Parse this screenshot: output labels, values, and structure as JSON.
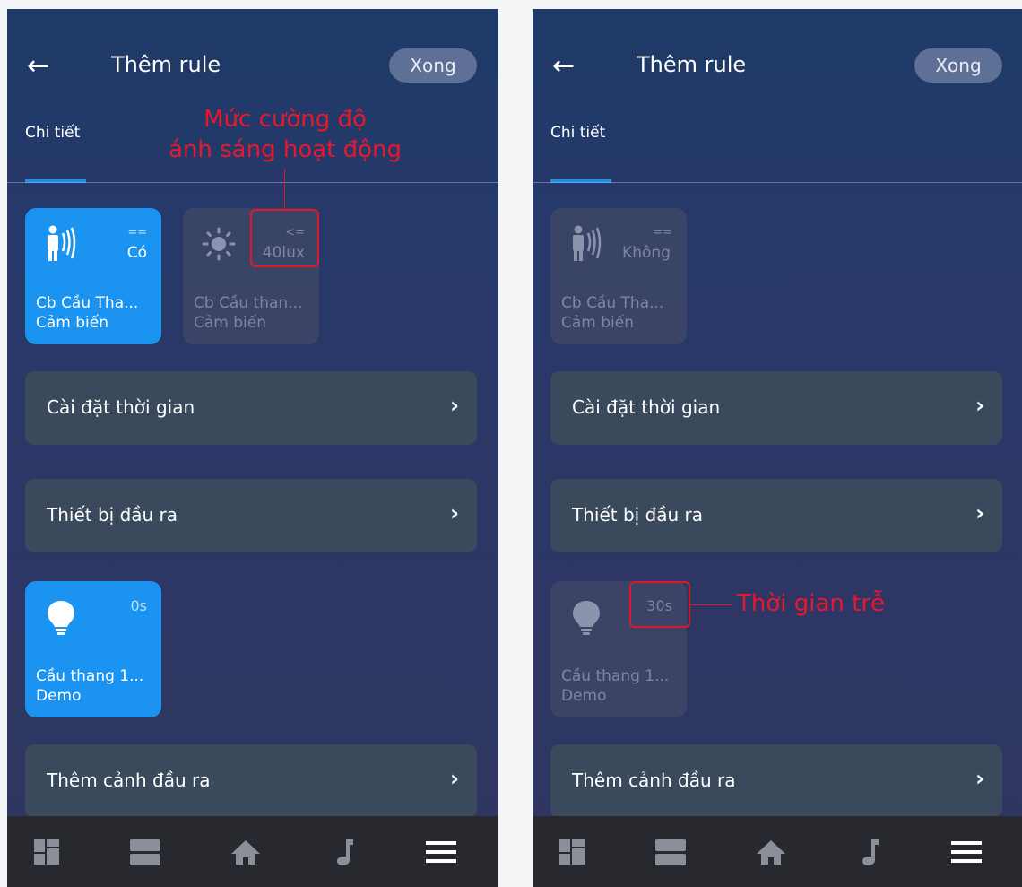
{
  "header": {
    "title": "Thêm rule",
    "done_label": "Xong"
  },
  "tab": {
    "label": "Chi tiết"
  },
  "left": {
    "sensor_cards": [
      {
        "operator": "==",
        "value": "Có",
        "name": "Cb Cầu Tha...",
        "subtitle": "Cảm biến",
        "icon": "motion-sensor-icon",
        "active": true
      },
      {
        "operator": "<=",
        "value": "40lux",
        "name": "Cb Cầu than...",
        "subtitle": "Cảm biến",
        "icon": "sun-icon",
        "active": false
      }
    ],
    "output_card": {
      "delay": "0s",
      "name": "Cầu thang 1...",
      "subtitle": "Demo",
      "icon": "lightbulb-icon",
      "active": true
    },
    "annotation": "Mức cường độ\nánh sáng hoạt động"
  },
  "right": {
    "sensor_cards": [
      {
        "operator": "==",
        "value": "Không",
        "name": "Cb Cầu Tha...",
        "subtitle": "Cảm biến",
        "icon": "motion-sensor-icon",
        "active": false
      }
    ],
    "output_card": {
      "delay": "30s",
      "name": "Cầu thang 1...",
      "subtitle": "Demo",
      "icon": "lightbulb-icon",
      "active": false
    },
    "annotation": "Thời gian trễ"
  },
  "rows": {
    "time_settings": "Cài đặt thời gian",
    "output_devices": "Thiết bị đầu ra",
    "add_output_scene": "Thêm cảnh đầu ra"
  },
  "bottom_nav": [
    "dashboard-icon",
    "rooms-icon",
    "home-icon",
    "music-icon",
    "menu-icon"
  ],
  "colors": {
    "accent": "#1a94f0",
    "annotation": "#e0182a",
    "row_bg": "#3a4a5c",
    "nav_bg": "#27292f"
  }
}
